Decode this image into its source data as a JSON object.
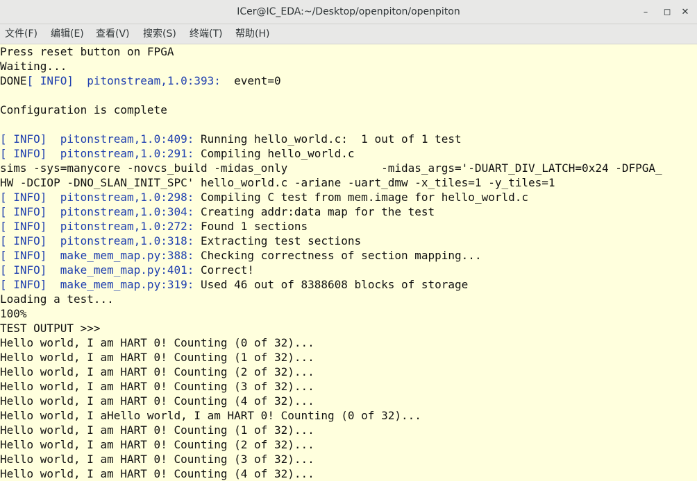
{
  "window": {
    "title": "ICer@IC_EDA:~/Desktop/openpiton/openpiton",
    "minimize_label": "–",
    "maximize_label": "◻",
    "close_label": "✕"
  },
  "menu": [
    {
      "label": "文件(F)"
    },
    {
      "label": "编辑(E)"
    },
    {
      "label": "查看(V)"
    },
    {
      "label": "搜索(S)"
    },
    {
      "label": "终端(T)"
    },
    {
      "label": "帮助(H)"
    }
  ],
  "terminal": {
    "lines": [
      {
        "text": "Press reset button on FPGA"
      },
      {
        "text": "Waiting..."
      },
      {
        "prefix": "DONE",
        "tag": "[ INFO]",
        "src": "  pitonstream,1.0:393:",
        "text": "  event=0"
      },
      {
        "text": ""
      },
      {
        "text": "Configuration is complete"
      },
      {
        "text": ""
      },
      {
        "tag": "[ INFO]",
        "src": "  pitonstream,1.0:409:",
        "text": " Running hello_world.c:  1 out of 1 test"
      },
      {
        "tag": "[ INFO]",
        "src": "  pitonstream,1.0:291:",
        "text": " Compiling hello_world.c"
      },
      {
        "text": "sims -sys=manycore -novcs_build -midas_only              -midas_args='-DUART_DIV_LATCH=0x24 -DFPGA_"
      },
      {
        "text": "HW -DCIOP -DNO_SLAN_INIT_SPC' hello_world.c -ariane -uart_dmw -x_tiles=1 -y_tiles=1"
      },
      {
        "tag": "[ INFO]",
        "src": "  pitonstream,1.0:298:",
        "text": " Compiling C test from mem.image for hello_world.c"
      },
      {
        "tag": "[ INFO]",
        "src": "  pitonstream,1.0:304:",
        "text": " Creating addr:data map for the test"
      },
      {
        "tag": "[ INFO]",
        "src": "  pitonstream,1.0:272:",
        "text": " Found 1 sections"
      },
      {
        "tag": "[ INFO]",
        "src": "  pitonstream,1.0:318:",
        "text": " Extracting test sections"
      },
      {
        "tag": "[ INFO]",
        "src": "  make_mem_map.py:388:",
        "text": " Checking correctness of section mapping..."
      },
      {
        "tag": "[ INFO]",
        "src": "  make_mem_map.py:401:",
        "text": " Correct!"
      },
      {
        "tag": "[ INFO]",
        "src": "  make_mem_map.py:319:",
        "text": " Used 46 out of 8388608 blocks of storage"
      },
      {
        "text": "Loading a test..."
      },
      {
        "text": "100%"
      },
      {
        "text": "TEST OUTPUT >>>"
      },
      {
        "text": "Hello world, I am HART 0! Counting (0 of 32)..."
      },
      {
        "text": "Hello world, I am HART 0! Counting (1 of 32)..."
      },
      {
        "text": "Hello world, I am HART 0! Counting (2 of 32)..."
      },
      {
        "text": "Hello world, I am HART 0! Counting (3 of 32)..."
      },
      {
        "text": "Hello world, I am HART 0! Counting (4 of 32)..."
      },
      {
        "text": "Hello world, I aHello world, I am HART 0! Counting (0 of 32)..."
      },
      {
        "text": "Hello world, I am HART 0! Counting (1 of 32)..."
      },
      {
        "text": "Hello world, I am HART 0! Counting (2 of 32)..."
      },
      {
        "text": "Hello world, I am HART 0! Counting (3 of 32)..."
      },
      {
        "text": "Hello world, I am HART 0! Counting (4 of 32)..."
      }
    ]
  }
}
